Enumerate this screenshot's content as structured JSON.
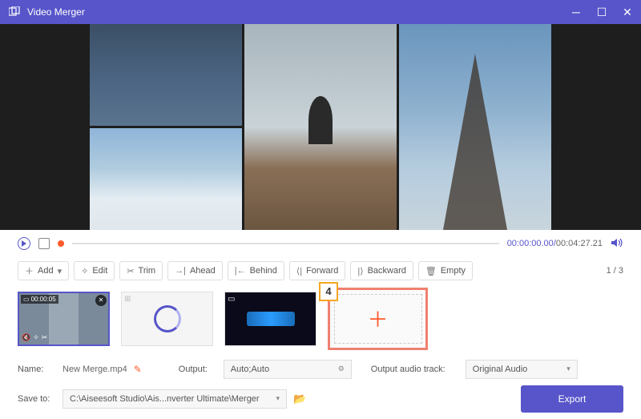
{
  "titlebar": {
    "title": "Video Merger"
  },
  "playback": {
    "current": "00:00:00.00",
    "total": "00:04:27.21"
  },
  "toolbar": {
    "add": "Add",
    "edit": "Edit",
    "trim": "Trim",
    "ahead": "Ahead",
    "behind": "Behind",
    "forward": "Forward",
    "backward": "Backward",
    "empty": "Empty",
    "page": "1 / 3"
  },
  "clips": {
    "clip1_ts": "00:00:05",
    "callout": "4"
  },
  "bottom": {
    "name_label": "Name:",
    "name_value": "New Merge.mp4",
    "output_label": "Output:",
    "output_value": "Auto;Auto",
    "audio_label": "Output audio track:",
    "audio_value": "Original Audio",
    "save_label": "Save to:",
    "save_value": "C:\\Aiseesoft Studio\\Ais...nverter Ultimate\\Merger",
    "export": "Export"
  }
}
